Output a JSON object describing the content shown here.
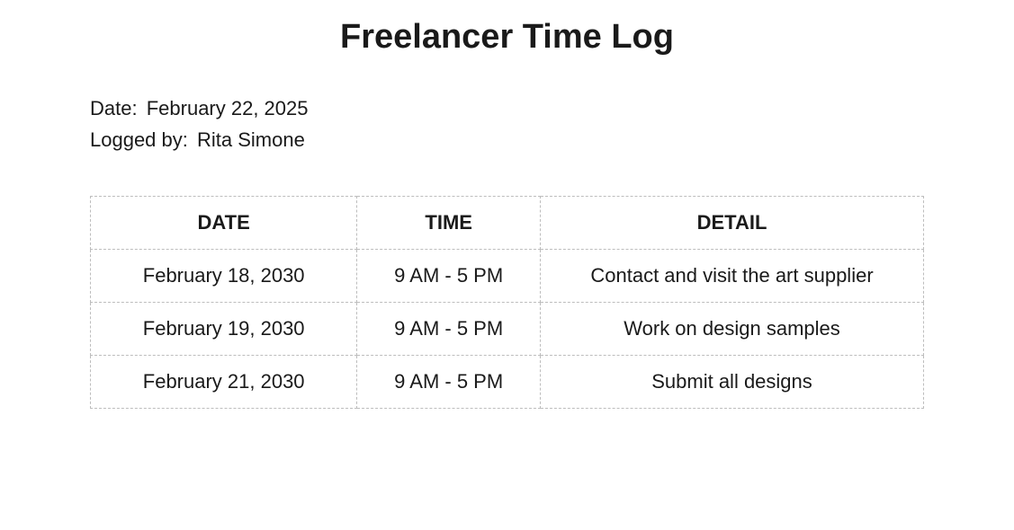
{
  "title": "Freelancer Time Log",
  "meta": {
    "date_label": "Date:",
    "date_value": "February 22, 2025",
    "logged_by_label": "Logged by:",
    "logged_by_value": "Rita Simone"
  },
  "table": {
    "headers": {
      "date": "DATE",
      "time": "TIME",
      "detail": "DETAIL"
    },
    "rows": [
      {
        "date": "February 18, 2030",
        "time": "9 AM - 5 PM",
        "detail": "Contact and visit the art supplier"
      },
      {
        "date": "February 19, 2030",
        "time": "9 AM - 5 PM",
        "detail": "Work on design samples"
      },
      {
        "date": "February 21, 2030",
        "time": "9 AM - 5 PM",
        "detail": "Submit all designs"
      }
    ]
  }
}
